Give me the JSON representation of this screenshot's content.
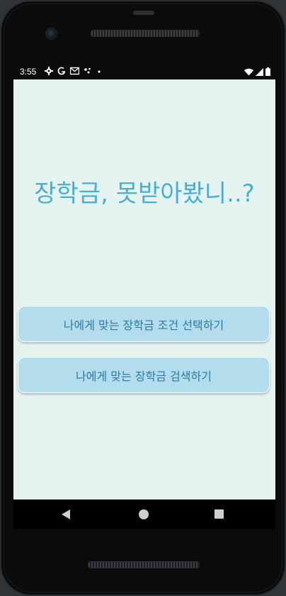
{
  "status_bar": {
    "time": "3:55",
    "left_icons": [
      "gear-icon",
      "google-g-icon",
      "mail-icon",
      "cast-dots-icon",
      "dot-icon"
    ],
    "right_icons": [
      "wifi-icon",
      "cell-signal-icon",
      "battery-icon"
    ]
  },
  "main": {
    "headline": "장학금, 못받아봤니..?",
    "buttons": [
      {
        "label": "나에게 맞는 장학금 조건 선택하기"
      },
      {
        "label": "나에게 맞는 장학금 검색하기"
      }
    ]
  },
  "nav_bar": {
    "icons": [
      "back-icon",
      "home-icon",
      "recents-icon"
    ]
  },
  "colors": {
    "screen_bg": "#e6f4f1",
    "accent_text": "#4aaed3",
    "button_bg": "#b3dced",
    "button_text": "#2b7aa3"
  }
}
